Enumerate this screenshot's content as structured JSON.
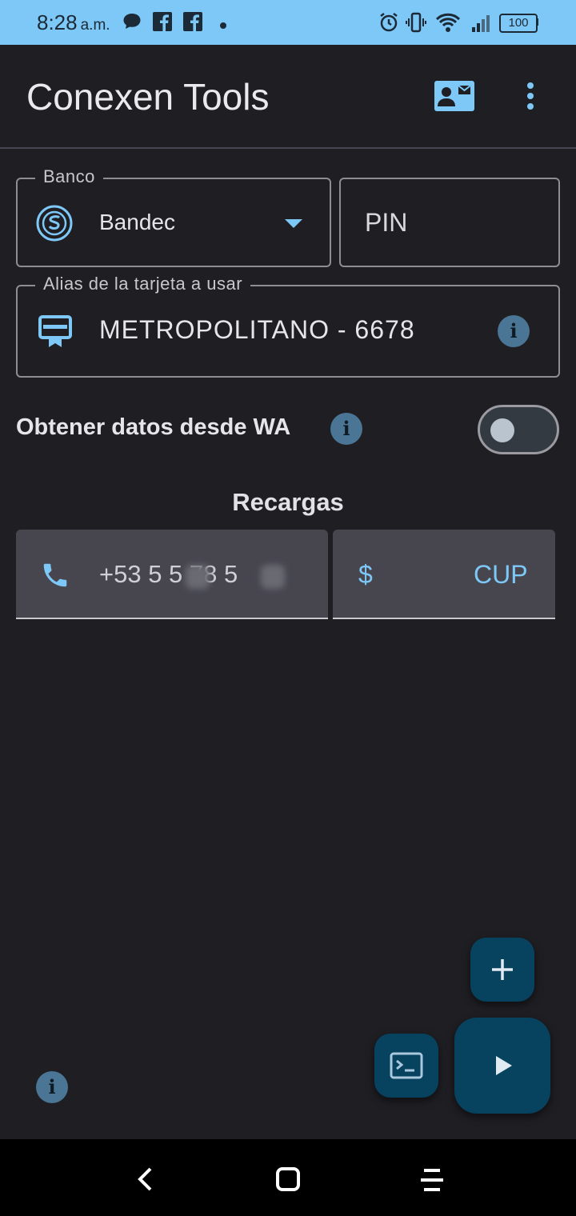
{
  "status_bar": {
    "time": "8:28",
    "ampm": "a.m.",
    "battery": "100",
    "icons": [
      "message-icon",
      "facebook-icon",
      "facebook-icon",
      "dot-icon",
      "alarm-icon",
      "vibrate-icon",
      "wifi-icon",
      "signal-icon",
      "battery-icon"
    ]
  },
  "app_bar": {
    "title": "Conexen Tools",
    "actions": [
      "contact-mail-icon",
      "more-vert-icon"
    ]
  },
  "form": {
    "bank_label": "Banco",
    "bank_value": "Bandec",
    "pin_placeholder": "PIN",
    "card_alias_label": "Alias de la tarjeta a usar",
    "card_alias_value": "METROPOLITANO - 6678",
    "wa_label": "Obtener datos desde WA",
    "wa_enabled": false
  },
  "recharges": {
    "title": "Recargas",
    "phone_value": "+53 5 5 78 5",
    "currency_symbol": "$",
    "currency": "CUP"
  },
  "colors": {
    "accent": "#7ec8f7",
    "fab": "#07425f",
    "background": "#1e1e23"
  }
}
